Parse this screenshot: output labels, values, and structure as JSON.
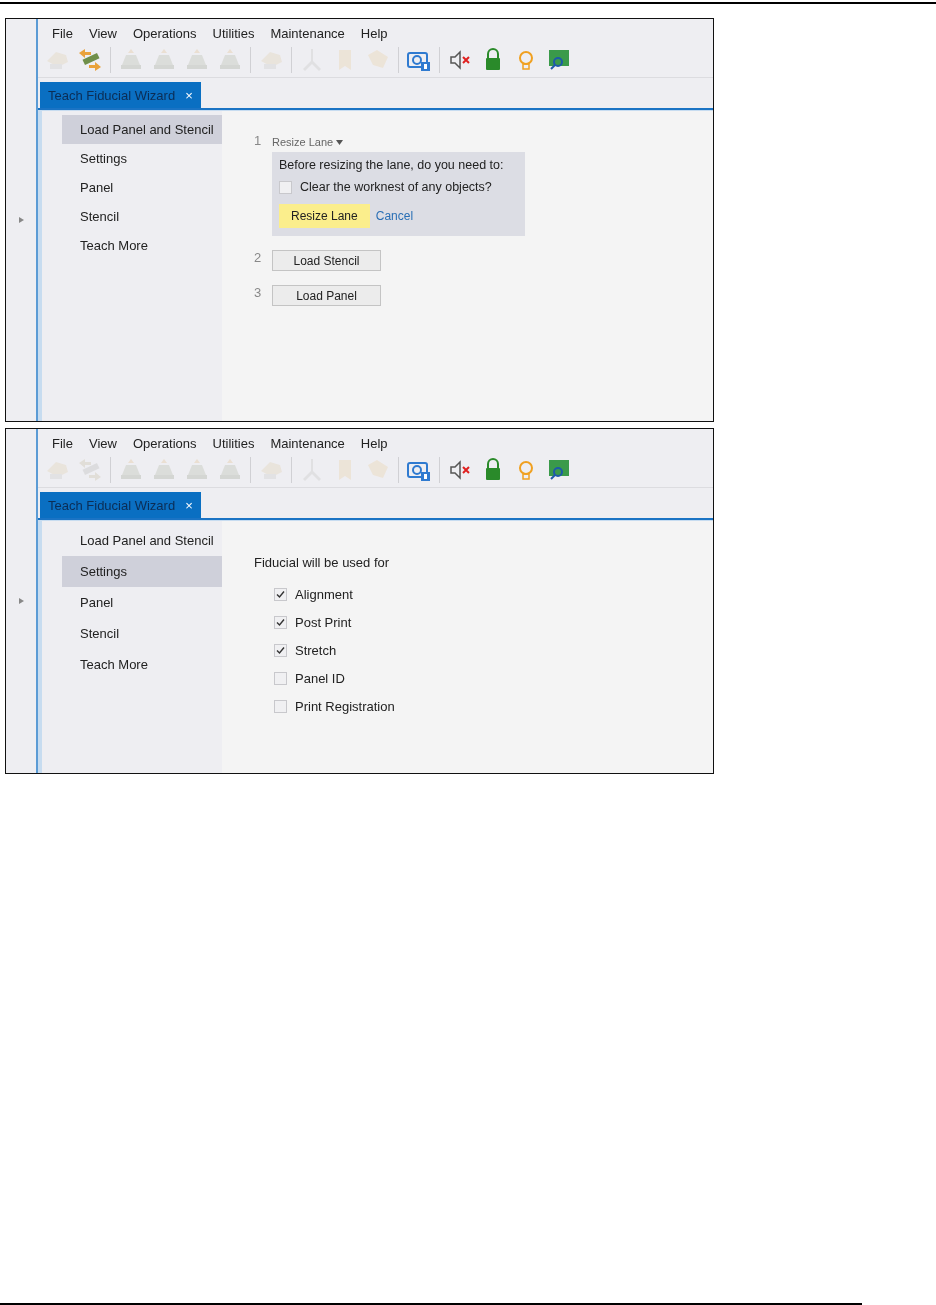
{
  "screenshots": [
    {
      "kind": "steps",
      "menu": [
        "File",
        "View",
        "Operations",
        "Utilities",
        "Maintenance",
        "Help"
      ],
      "toolbar": [
        {
          "disabled": true
        },
        {
          "disabled": false
        },
        {
          "disabled": true
        },
        {
          "disabled": true
        },
        {
          "disabled": true
        },
        {
          "disabled": true
        },
        {
          "disabled": true
        },
        {
          "disabled": true
        },
        {
          "disabled": true
        },
        {
          "disabled": true
        },
        {
          "disabled": false
        },
        {
          "disabled": false
        },
        {
          "disabled": false
        },
        {
          "disabled": false
        },
        {
          "disabled": false
        }
      ],
      "tab": {
        "label": "Teach Fiducial Wizard",
        "close": "×"
      },
      "sidebar": [
        {
          "label": "Load Panel and Stencil",
          "selected": true
        },
        {
          "label": "Settings",
          "selected": false
        },
        {
          "label": "Panel",
          "selected": false
        },
        {
          "label": "Stencil",
          "selected": false
        },
        {
          "label": "Teach More",
          "selected": false
        }
      ],
      "steps": [
        {
          "number": "1",
          "kind": "dropdown",
          "label": "Resize Lane",
          "popup": {
            "question": "Before resizing the lane, do you need to:",
            "option": {
              "label": "Clear the worknest of any objects?",
              "checked": false
            },
            "confirm": "Resize Lane",
            "cancel": "Cancel"
          }
        },
        {
          "number": "2",
          "kind": "button",
          "label": "Load Stencil"
        },
        {
          "number": "3",
          "kind": "button",
          "label": "Load Panel"
        }
      ]
    },
    {
      "kind": "options",
      "menu": [
        "File",
        "View",
        "Operations",
        "Utilities",
        "Maintenance",
        "Help"
      ],
      "toolbar": [
        {
          "disabled": true
        },
        {
          "disabled": true
        },
        {
          "disabled": true
        },
        {
          "disabled": true
        },
        {
          "disabled": true
        },
        {
          "disabled": true
        },
        {
          "disabled": true
        },
        {
          "disabled": true
        },
        {
          "disabled": true
        },
        {
          "disabled": true
        },
        {
          "disabled": false
        },
        {
          "disabled": false
        },
        {
          "disabled": false
        },
        {
          "disabled": false
        },
        {
          "disabled": false
        }
      ],
      "tab": {
        "label": "Teach Fiducial Wizard",
        "close": "×"
      },
      "sidebar": [
        {
          "label": "Load Panel and Stencil",
          "selected": false
        },
        {
          "label": "Settings",
          "selected": true
        },
        {
          "label": "Panel",
          "selected": false
        },
        {
          "label": "Stencil",
          "selected": false
        },
        {
          "label": "Teach More",
          "selected": false
        }
      ],
      "heading": "Fiducial will be used for",
      "options": [
        {
          "label": "Alignment",
          "checked": true
        },
        {
          "label": "Post Print",
          "checked": true
        },
        {
          "label": "Stretch",
          "checked": true
        },
        {
          "label": "Panel ID",
          "checked": false
        },
        {
          "label": "Print Registration",
          "checked": false
        }
      ]
    }
  ]
}
